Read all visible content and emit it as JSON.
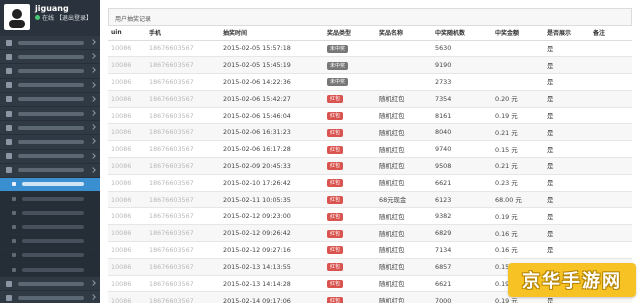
{
  "user": {
    "name": "jiguang",
    "status": "在线",
    "logout": "【退出登录】"
  },
  "colors": {
    "sidebar_bg": "#2f3a45",
    "active_item": "#3a8fd0",
    "tag_red": "#d9534f",
    "tag_gray": "#777777",
    "watermark_bg": "#f7c324"
  },
  "sidebar": {
    "items": [
      {
        "type": "top",
        "state": "normal"
      },
      {
        "type": "top",
        "state": "normal"
      },
      {
        "type": "top",
        "state": "normal"
      },
      {
        "type": "top",
        "state": "normal"
      },
      {
        "type": "top",
        "state": "normal"
      },
      {
        "type": "top",
        "state": "normal"
      },
      {
        "type": "top",
        "state": "normal"
      },
      {
        "type": "top",
        "state": "normal"
      },
      {
        "type": "top",
        "state": "normal"
      },
      {
        "type": "top",
        "state": "normal"
      },
      {
        "type": "sub",
        "state": "active"
      },
      {
        "type": "sub",
        "state": "normal"
      },
      {
        "type": "sub",
        "state": "normal"
      },
      {
        "type": "sub",
        "state": "normal"
      },
      {
        "type": "sub",
        "state": "normal"
      },
      {
        "type": "sub",
        "state": "normal"
      },
      {
        "type": "sub",
        "state": "normal"
      },
      {
        "type": "top",
        "state": "normal"
      },
      {
        "type": "top",
        "state": "normal"
      }
    ]
  },
  "panel": {
    "title": "用户抽奖记录"
  },
  "table": {
    "headers": [
      "uin",
      "手机",
      "抽奖时间",
      "奖品类型",
      "奖品名称",
      "中奖随机数",
      "中奖金额",
      "是否展示",
      "备注"
    ],
    "rows": [
      {
        "uin": "10086",
        "phone": "18676603567",
        "time": "2015-02-05 15:57:18",
        "type": "未中奖",
        "type_color": "gray",
        "name": "",
        "rand": "5630",
        "amount": "",
        "shown": "是",
        "note": ""
      },
      {
        "uin": "10086",
        "phone": "18676603567",
        "time": "2015-02-05 15:45:19",
        "type": "未中奖",
        "type_color": "gray",
        "name": "",
        "rand": "9190",
        "amount": "",
        "shown": "是",
        "note": ""
      },
      {
        "uin": "10086",
        "phone": "18676603567",
        "time": "2015-02-06 14:22:36",
        "type": "未中奖",
        "type_color": "gray",
        "name": "",
        "rand": "2733",
        "amount": "",
        "shown": "是",
        "note": ""
      },
      {
        "uin": "10086",
        "phone": "18676603567",
        "time": "2015-02-06 15:42:27",
        "type": "红包",
        "type_color": "red",
        "name": "随机红包",
        "rand": "7354",
        "amount": "0.20 元",
        "shown": "是",
        "note": ""
      },
      {
        "uin": "10086",
        "phone": "18676603567",
        "time": "2015-02-06 15:46:04",
        "type": "红包",
        "type_color": "red",
        "name": "随机红包",
        "rand": "8161",
        "amount": "0.19 元",
        "shown": "是",
        "note": ""
      },
      {
        "uin": "10086",
        "phone": "18676603567",
        "time": "2015-02-06 16:31:23",
        "type": "红包",
        "type_color": "red",
        "name": "随机红包",
        "rand": "8040",
        "amount": "0.21 元",
        "shown": "是",
        "note": ""
      },
      {
        "uin": "10086",
        "phone": "18676603567",
        "time": "2015-02-06 16:17:28",
        "type": "红包",
        "type_color": "red",
        "name": "随机红包",
        "rand": "9740",
        "amount": "0.15 元",
        "shown": "是",
        "note": ""
      },
      {
        "uin": "10086",
        "phone": "18676603567",
        "time": "2015-02-09 20:45:33",
        "type": "红包",
        "type_color": "red",
        "name": "随机红包",
        "rand": "9508",
        "amount": "0.21 元",
        "shown": "是",
        "note": ""
      },
      {
        "uin": "10086",
        "phone": "18676603567",
        "time": "2015-02-10 17:26:42",
        "type": "红包",
        "type_color": "red",
        "name": "随机红包",
        "rand": "6621",
        "amount": "0.23 元",
        "shown": "是",
        "note": ""
      },
      {
        "uin": "10086",
        "phone": "18676603567",
        "time": "2015-02-11 10:05:35",
        "type": "红包",
        "type_color": "red",
        "name": "68元现金",
        "rand": "6123",
        "amount": "68.00 元",
        "shown": "是",
        "note": ""
      },
      {
        "uin": "10086",
        "phone": "18676603567",
        "time": "2015-02-12 09:23:00",
        "type": "红包",
        "type_color": "red",
        "name": "随机红包",
        "rand": "9382",
        "amount": "0.19 元",
        "shown": "是",
        "note": ""
      },
      {
        "uin": "10086",
        "phone": "18676603567",
        "time": "2015-02-12 09:26:42",
        "type": "红包",
        "type_color": "red",
        "name": "随机红包",
        "rand": "6829",
        "amount": "0.16 元",
        "shown": "是",
        "note": ""
      },
      {
        "uin": "10086",
        "phone": "18676603567",
        "time": "2015-02-12 09:27:16",
        "type": "红包",
        "type_color": "red",
        "name": "随机红包",
        "rand": "7134",
        "amount": "0.16 元",
        "shown": "是",
        "note": ""
      },
      {
        "uin": "10086",
        "phone": "18676603567",
        "time": "2015-02-13 14:13:55",
        "type": "红包",
        "type_color": "red",
        "name": "随机红包",
        "rand": "6857",
        "amount": "0.15 元",
        "shown": "是",
        "note": ""
      },
      {
        "uin": "10086",
        "phone": "18676603567",
        "time": "2015-02-13 14:14:28",
        "type": "红包",
        "type_color": "red",
        "name": "随机红包",
        "rand": "6621",
        "amount": "0.19 元",
        "shown": "是",
        "note": ""
      },
      {
        "uin": "10086",
        "phone": "18676603567",
        "time": "2015-02-14 09:17:06",
        "type": "红包",
        "type_color": "red",
        "name": "随机红包",
        "rand": "7000",
        "amount": "0.19 元",
        "shown": "是",
        "note": ""
      }
    ]
  },
  "watermark": {
    "text": "京华手游网"
  }
}
